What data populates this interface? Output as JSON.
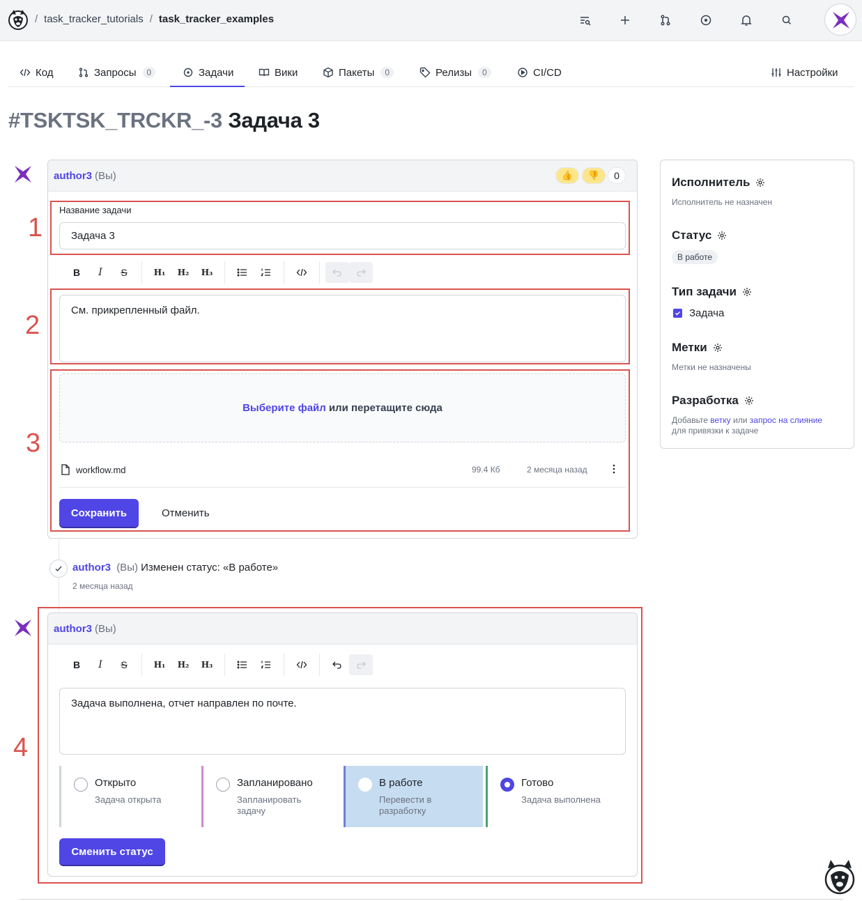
{
  "breadcrumbs": {
    "org": "task_tracker_tutorials",
    "sep": "/",
    "repo": "task_tracker_examples"
  },
  "tabs": [
    {
      "label": "Код"
    },
    {
      "label": "Запросы",
      "count": "0"
    },
    {
      "label": "Задачи"
    },
    {
      "label": "Вики"
    },
    {
      "label": "Пакеты",
      "count": "0"
    },
    {
      "label": "Релизы",
      "count": "0"
    },
    {
      "label": "CI/CD"
    },
    {
      "label": "Настройки"
    }
  ],
  "issue": {
    "id": "#TSKTSK_TRCKR_-3",
    "title": "Задача 3"
  },
  "edit_comment": {
    "author": "author3",
    "you": "(Вы)",
    "reaction_count": "0",
    "title_label": "Название задачи",
    "title_value": "Задача 3",
    "body": "См. прикрепленный файл.",
    "drop_link": "Выберите файл",
    "drop_rest": "или перетащите сюда",
    "file": {
      "name": "workflow.md",
      "size": "99.4 Кб",
      "time": "2 месяца назад"
    },
    "save": "Сохранить",
    "cancel": "Отменить"
  },
  "toolbar": {
    "bold": "B",
    "italic": "I",
    "strike": "S",
    "h1": "H₁",
    "h2": "H₂",
    "h3": "H₃"
  },
  "event": {
    "author": "author3",
    "you": "(Вы)",
    "text": "Изменен статус: «В работе»",
    "time": "2 месяца назад"
  },
  "new_comment": {
    "author": "author3",
    "you": "(Вы)",
    "body": "Задача выполнена, отчет направлен по почте.",
    "submit": "Сменить статус",
    "options": [
      {
        "title": "Открыто",
        "desc": "Задача открыта",
        "color": "#d1d5db",
        "checked": false
      },
      {
        "title": "Запланировано",
        "desc": "Запланировать задачу",
        "color": "#d08ac9",
        "checked": false
      },
      {
        "title": "В работе",
        "desc": "Перевести в разработку",
        "color": "#6d82d6",
        "checked": false
      },
      {
        "title": "Готово",
        "desc": "Задача выполнена",
        "color": "#4aa36b",
        "checked": true
      }
    ]
  },
  "annotations": [
    "1",
    "2",
    "3",
    "4"
  ],
  "sidebar": {
    "assignee_title": "Исполнитель",
    "assignee_value": "Исполнитель не назначен",
    "status_title": "Статус",
    "status_value": "В работе",
    "type_title": "Тип задачи",
    "type_value": "Задача",
    "labels_title": "Метки",
    "labels_value": "Метки не назначены",
    "dev_title": "Разработка",
    "dev_text_1": "Добавьте",
    "dev_link_1": "ветку",
    "dev_text_2": "или",
    "dev_link_2": "запрос на слияние",
    "dev_text_3": "для привязки к задаче"
  },
  "colors": {
    "accent": "#4f46e5",
    "annotation": "#d9534f",
    "avatar": "#7b2fbe"
  }
}
